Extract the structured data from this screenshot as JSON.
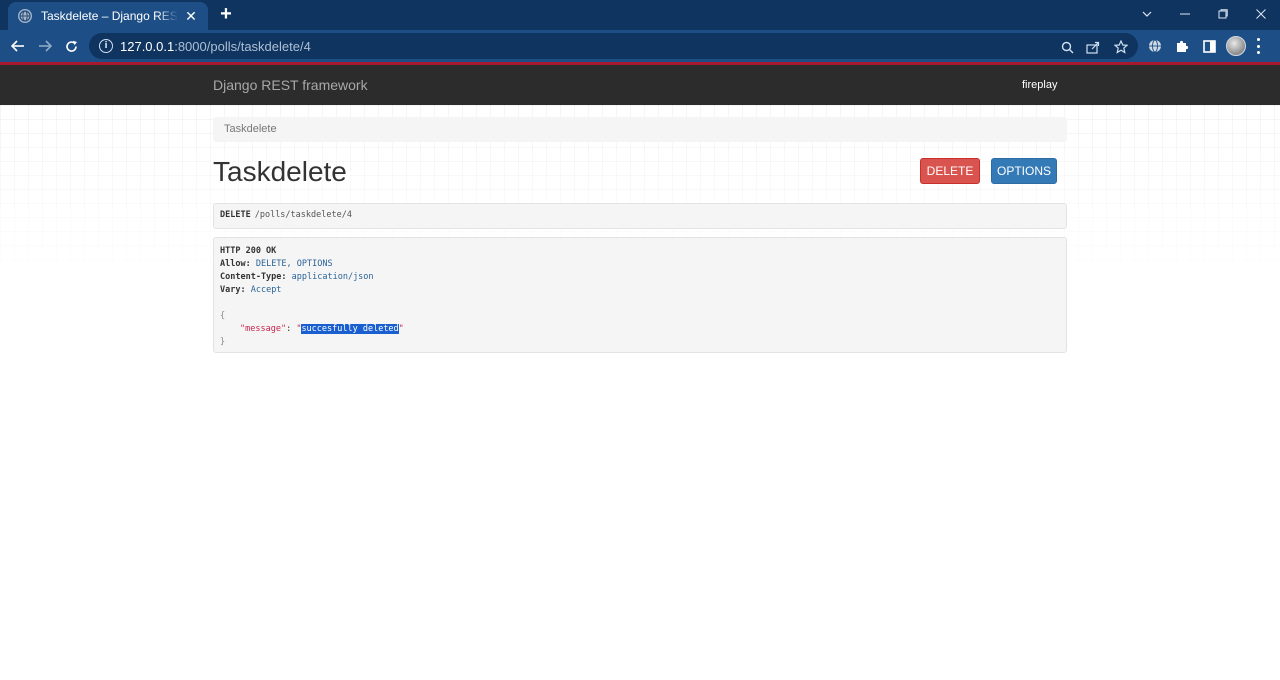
{
  "browser": {
    "tab_title": "Taskdelete – Django REST framework",
    "tab_close": "✕",
    "new_tab": "+",
    "url_host": "127.0.0.1",
    "url_rest": ":8000/polls/taskdelete/4"
  },
  "navbar": {
    "brand": "Django REST framework",
    "user": "fireplay"
  },
  "breadcrumb": "Taskdelete",
  "title": "Taskdelete",
  "buttons": {
    "delete": "DELETE",
    "options": "OPTIONS"
  },
  "request": {
    "method": "DELETE",
    "path": "/polls/taskdelete/4"
  },
  "response": {
    "status": "HTTP 200 OK",
    "headers": [
      {
        "name": "Allow:",
        "value": "DELETE, OPTIONS"
      },
      {
        "name": "Content-Type:",
        "value": "application/json"
      },
      {
        "name": "Vary:",
        "value": "Accept"
      }
    ],
    "json_open": "{",
    "json_key": "\"message\"",
    "json_colon": ": ",
    "json_quote_open": "\"",
    "json_value": "succesfully deleted",
    "json_quote_close": "\"",
    "json_close": "}"
  },
  "colors": {
    "navbar_bg": "#2c2c2c",
    "delete_btn": "#d9534f",
    "options_btn": "#337ab7",
    "browser_frame": "#1d4f86",
    "accent_line": "#a6192e"
  }
}
